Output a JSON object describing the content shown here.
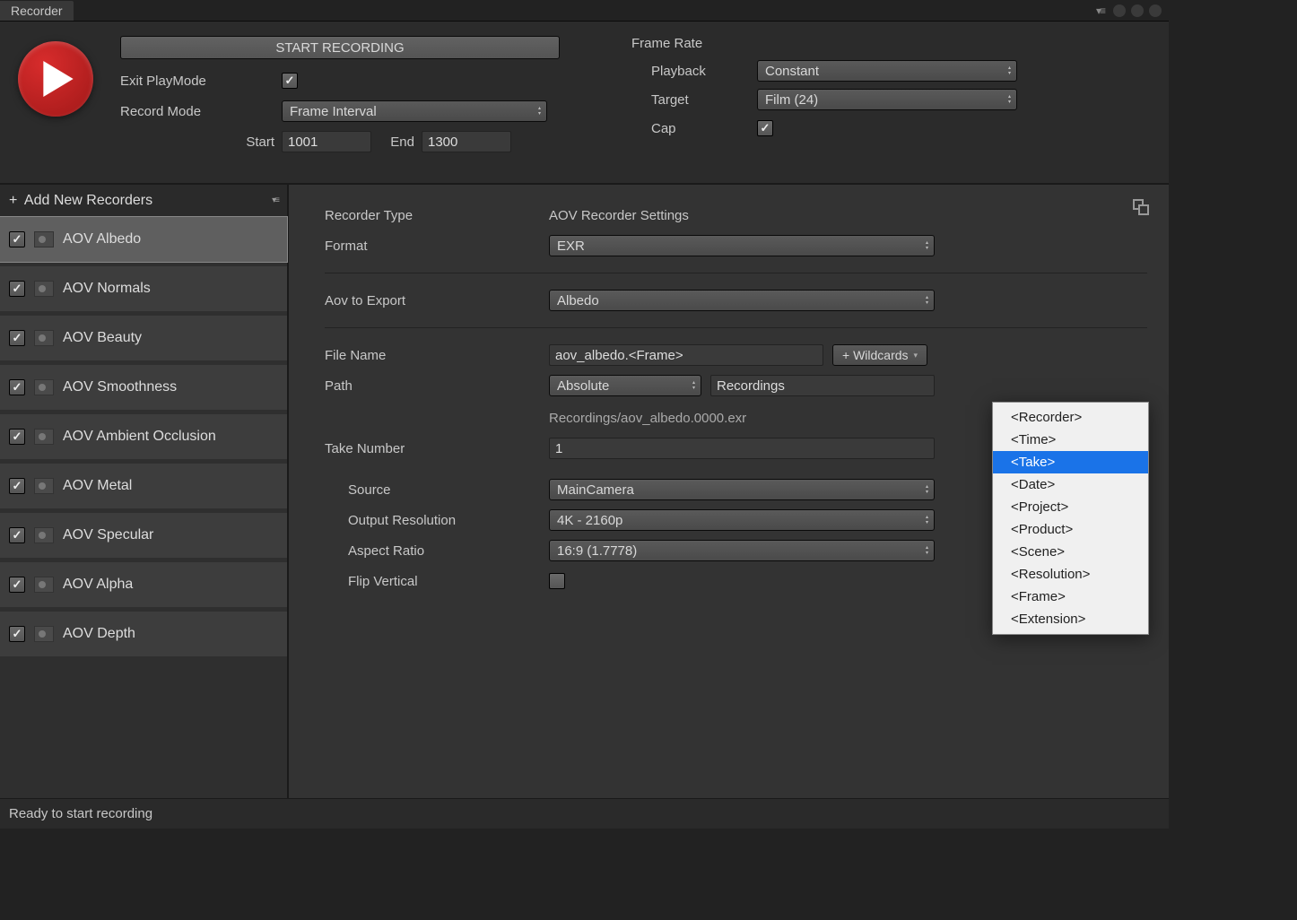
{
  "tab": {
    "title": "Recorder"
  },
  "toolbar": {
    "start_recording": "START RECORDING",
    "exit_playmode_label": "Exit PlayMode",
    "record_mode_label": "Record Mode",
    "record_mode_value": "Frame Interval",
    "start_label": "Start",
    "start_value": "1001",
    "end_label": "End",
    "end_value": "1300"
  },
  "framerate": {
    "title": "Frame Rate",
    "playback_label": "Playback",
    "playback_value": "Constant",
    "target_label": "Target",
    "target_value": "Film (24)",
    "cap_label": "Cap"
  },
  "sidebar": {
    "add_label": "Add New Recorders",
    "items": [
      {
        "label": "AOV Albedo",
        "selected": true
      },
      {
        "label": "AOV Normals",
        "selected": false
      },
      {
        "label": "AOV Beauty",
        "selected": false
      },
      {
        "label": "AOV Smoothness",
        "selected": false
      },
      {
        "label": "AOV Ambient Occlusion",
        "selected": false
      },
      {
        "label": "AOV Metal",
        "selected": false
      },
      {
        "label": "AOV Specular",
        "selected": false
      },
      {
        "label": "AOV Alpha",
        "selected": false
      },
      {
        "label": "AOV Depth",
        "selected": false
      }
    ]
  },
  "inspector": {
    "recorder_type_label": "Recorder Type",
    "recorder_type_value": "AOV Recorder Settings",
    "format_label": "Format",
    "format_value": "EXR",
    "aov_export_label": "Aov to Export",
    "aov_export_value": "Albedo",
    "filename_label": "File Name",
    "filename_value": "aov_albedo.<Frame>",
    "wildcards_btn": "+ Wildcards",
    "path_label": "Path",
    "path_type": "Absolute",
    "path_value": "Recordings",
    "resolved_path": "Recordings/aov_albedo.0000.exr",
    "take_label": "Take Number",
    "take_value": "1",
    "source_label": "Source",
    "source_value": "MainCamera",
    "output_res_label": "Output Resolution",
    "output_res_value": "4K - 2160p",
    "aspect_label": "Aspect Ratio",
    "aspect_value": "16:9 (1.7778)",
    "flip_label": "Flip Vertical"
  },
  "wildcards_popup": {
    "items": [
      "<Recorder>",
      "<Time>",
      "<Take>",
      "<Date>",
      "<Project>",
      "<Product>",
      "<Scene>",
      "<Resolution>",
      "<Frame>",
      "<Extension>"
    ],
    "selected": "<Take>"
  },
  "status": {
    "text": "Ready to start recording"
  }
}
